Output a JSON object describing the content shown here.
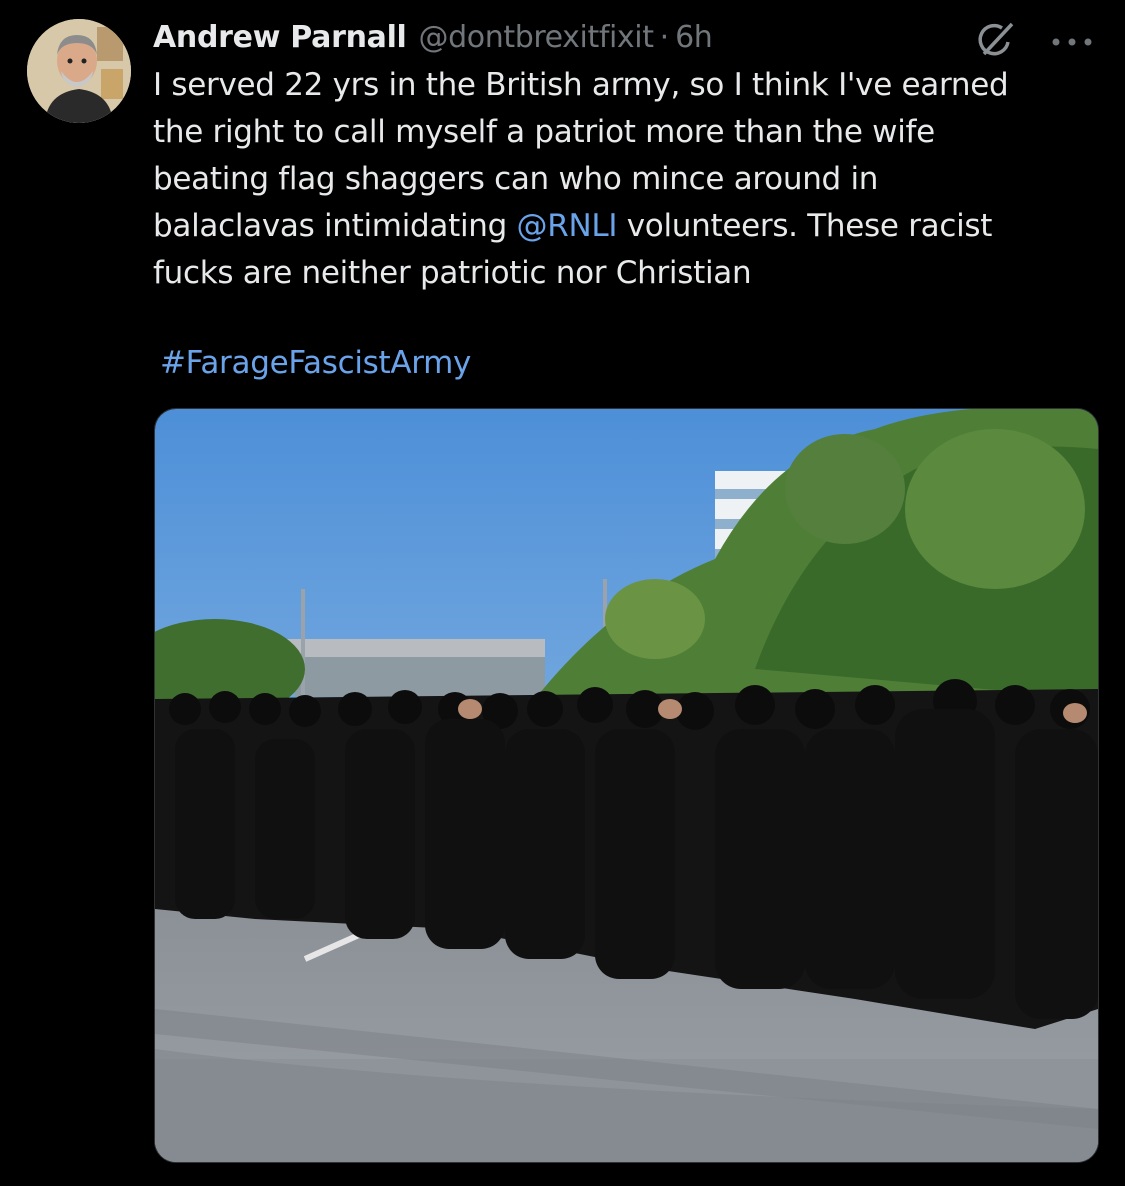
{
  "tweet": {
    "author": {
      "display_name": "Andrew Parnall",
      "handle": "@dontbrexitfixit",
      "separator": "·",
      "time": "6h"
    },
    "text_part1": "I served 22 yrs in the British army, so I think I've earned\nthe right to call myself a patriot more than the wife\nbeating flag shaggers can who mince around in\nbalaclavas intimidating ",
    "mention": "@RNLI",
    "text_part2": " volunteers. These racist\nfucks are neither patriotic nor Christian",
    "hashtag": "#FarageFascistArmy",
    "media": {
      "kind": "photo",
      "scene": "crowd of people dressed in black with faces covered, standing on a road in sunlight, trees and a building behind"
    },
    "icons": {
      "avatar": "avatar-cartoon-man",
      "grok": "grok-icon",
      "more": "more-options-icon"
    },
    "colors": {
      "background": "#000000",
      "text": "#e7e9ea",
      "secondary_text": "#71767b",
      "link": "#6aa3ea"
    }
  }
}
